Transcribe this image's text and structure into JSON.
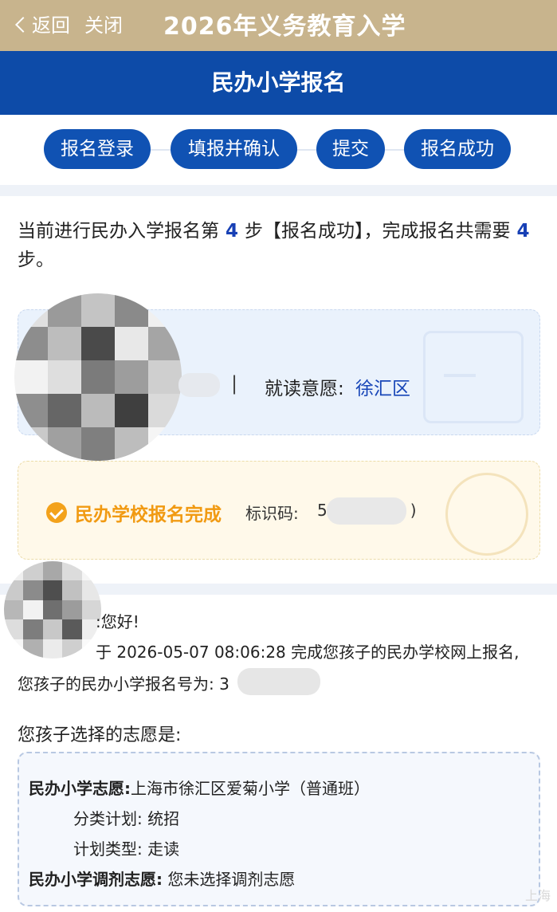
{
  "topbar": {
    "back_label": "返回",
    "close_label": "关闭",
    "title": "2026年义务教育入学"
  },
  "header": {
    "title": "民办小学报名"
  },
  "steps": [
    "报名登录",
    "填报并确认",
    "提交",
    "报名成功"
  ],
  "progress": {
    "prefix": "当前进行民办入学报名第",
    "current": "4",
    "middle": "步【报名成功】，完成报名共需要",
    "total": "4",
    "suffix": "步。"
  },
  "student": {
    "separator": "|",
    "intent_label": "就读意愿:",
    "intent_value": "徐汇区"
  },
  "status": {
    "text": "民办学校报名完成",
    "code_label": "标识码:",
    "code_visible": "5",
    "code_tail": ")"
  },
  "message": {
    "greeting": ":您好!",
    "line1": "于 2026-05-07 08:06:28 完成您孩子的民办学校网上报名,",
    "line2": "您孩子的民办小学报名号为: 3"
  },
  "wishes": {
    "title": "您孩子选择的志愿是:",
    "primary_label": "民办小学志愿:",
    "primary_value": "上海市徐汇区爱菊小学（普通班）",
    "category_label": "分类计划:",
    "category_value": "统招",
    "plan_type_label": "计划类型:",
    "plan_type_value": "走读",
    "adjust_label": "民办小学调剂志愿:",
    "adjust_value": "您未选择调剂志愿"
  },
  "watermark": "上海",
  "colors": {
    "gold": "#c8b48d",
    "blue": "#0d4ba8",
    "accent_orange": "#f19a12",
    "link_blue": "#1846b8"
  },
  "icons": [
    "chevron-left-icon",
    "check-circle-icon"
  ]
}
